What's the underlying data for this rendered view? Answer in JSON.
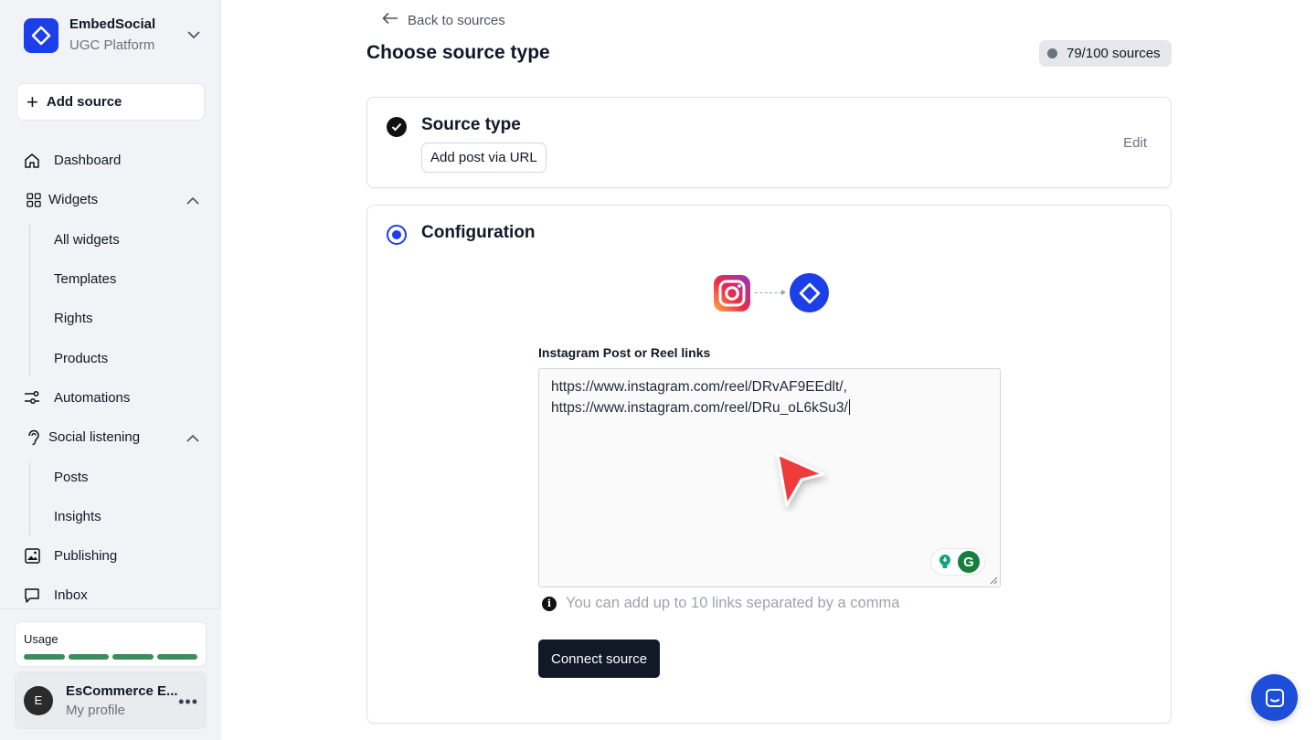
{
  "brand": {
    "name": "EmbedSocial",
    "subtitle": "UGC Platform"
  },
  "sidebar": {
    "add_source": "Add source",
    "items": [
      {
        "label": "Dashboard",
        "icon": "home-icon"
      },
      {
        "label": "Widgets",
        "icon": "grid-icon",
        "expanded": true
      },
      {
        "label": "All widgets"
      },
      {
        "label": "Templates"
      },
      {
        "label": "Rights"
      },
      {
        "label": "Products"
      },
      {
        "label": "Automations",
        "icon": "automations-icon"
      },
      {
        "label": "Social listening",
        "icon": "ear-icon",
        "expanded": true
      },
      {
        "label": "Posts"
      },
      {
        "label": "Insights"
      },
      {
        "label": "Publishing",
        "icon": "image-icon"
      },
      {
        "label": "Inbox",
        "icon": "chat-icon"
      }
    ],
    "usage_label": "Usage",
    "profile": {
      "initial": "E",
      "name": "EsCommerce E...",
      "sub": "My profile"
    }
  },
  "main": {
    "back_label": "Back to sources",
    "title": "Choose source type",
    "quota": "79/100 sources",
    "source_type": {
      "title": "Source type",
      "tag": "Add post via URL",
      "edit": "Edit"
    },
    "configuration": {
      "title": "Configuration",
      "field_label": "Instagram Post or Reel links",
      "textarea_lines": [
        "https://www.instagram.com/reel/DRvAF9EEdlt/,",
        "https://www.instagram.com/reel/DRu_oL6kSu3/"
      ],
      "hint": "You can add up to 10 links separated by a comma",
      "connect_label": "Connect source"
    }
  },
  "colors": {
    "accent": "#1d3fe8",
    "usage_bar": "#3b8e5a",
    "pointer": "#ef3b3b",
    "dark_button": "#111827"
  }
}
